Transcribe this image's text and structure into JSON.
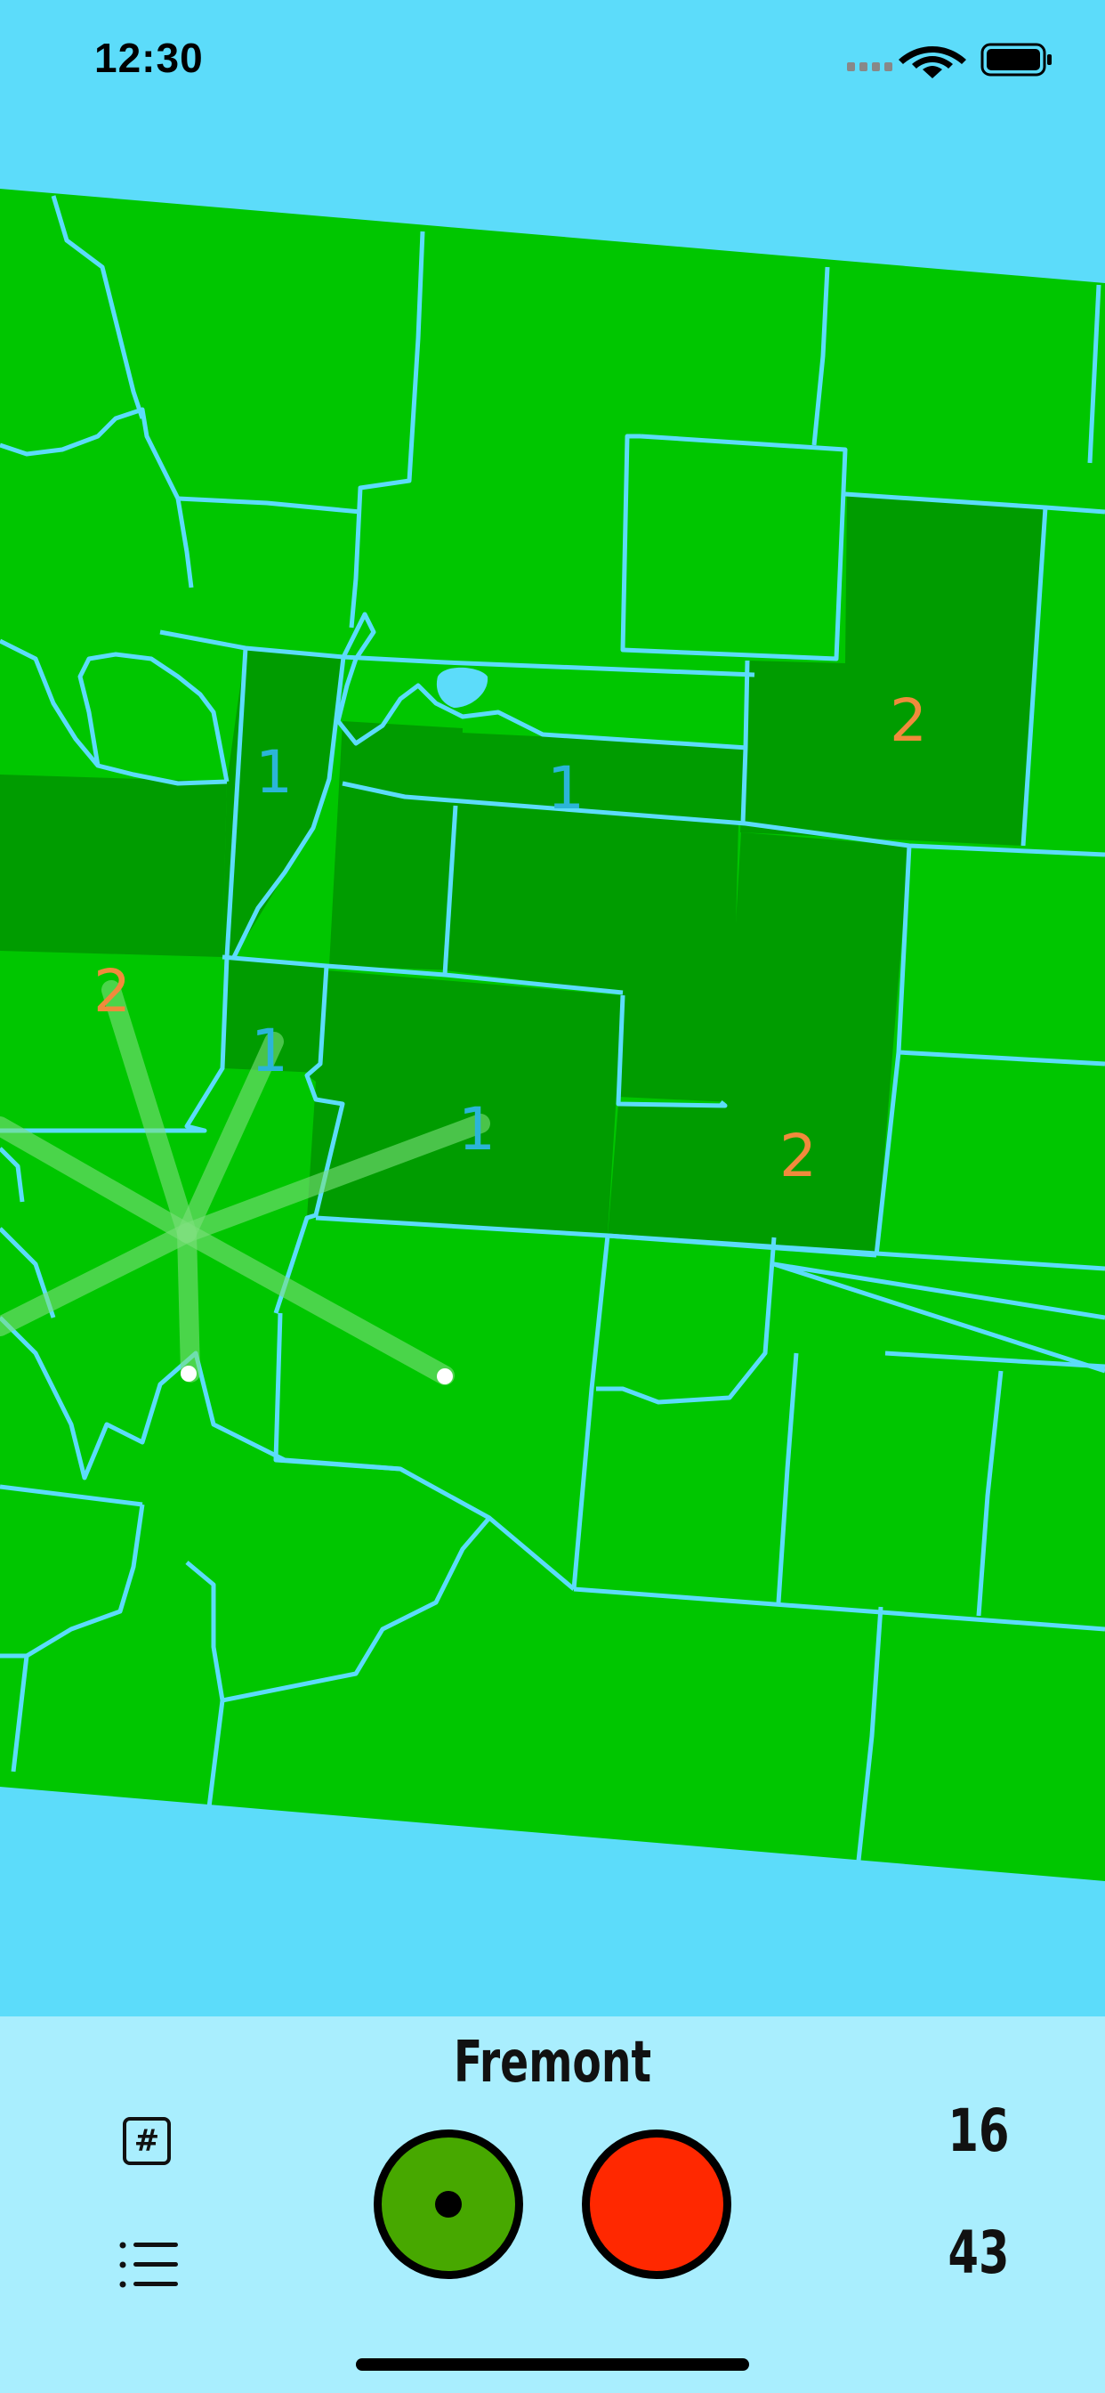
{
  "status_bar": {
    "time": "12:30",
    "icons": [
      "cellular-icon",
      "wifi-icon",
      "battery-icon"
    ]
  },
  "map": {
    "base_color": "#00c600",
    "selected_color": "#009c00",
    "border_color": "#5cdcfa",
    "labels": [
      {
        "text": "1",
        "color": "#2bb5d8"
      },
      {
        "text": "1",
        "color": "#2bb5d8"
      },
      {
        "text": "2",
        "color": "#f08a3c"
      },
      {
        "text": "2",
        "color": "#f08a3c"
      },
      {
        "text": "1",
        "color": "#2bb5d8"
      },
      {
        "text": "1",
        "color": "#2bb5d8"
      },
      {
        "text": "2",
        "color": "#f08a3c"
      }
    ]
  },
  "bottom_panel": {
    "county_name": "Fremont",
    "hash_label": "#",
    "count_top": "16",
    "count_bottom": "43",
    "green_button_color": "#47a800",
    "red_button_color": "#ff2800"
  }
}
